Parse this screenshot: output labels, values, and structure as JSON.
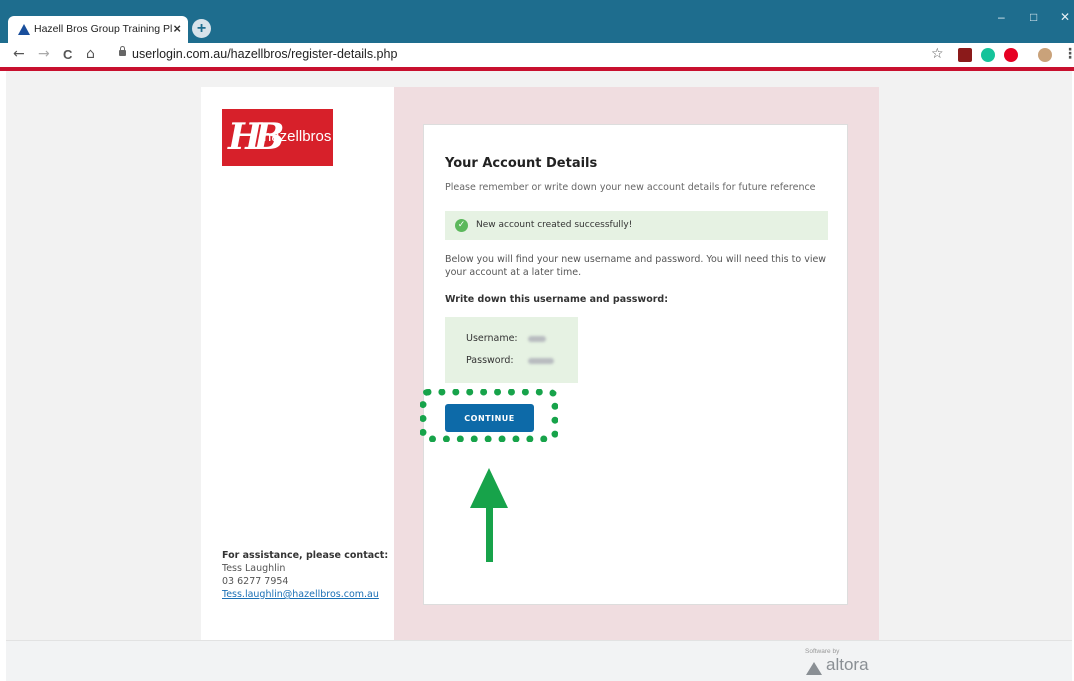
{
  "browser": {
    "tab_title": "Hazell Bros Group Training Platfo",
    "tab_close": "×",
    "new_tab": "+",
    "url": "userlogin.com.au/hazellbros/register-details.php",
    "window_controls": {
      "minimize": "–",
      "maximize": "□",
      "close": "✕"
    },
    "nav": {
      "back": "←",
      "forward": "→",
      "reload": "C",
      "home": "⌂"
    },
    "star": "☆",
    "menu": "⋮"
  },
  "brand": {
    "logo_mark": "HB",
    "logo_text": "hazellbros",
    "color": "#d7202a"
  },
  "card": {
    "title": "Your Account Details",
    "subtitle": "Please remember or write down your new account details for future reference",
    "success_message": "New account created successfully!",
    "info_text": "Below you will find your new username and password. You will need this to view your account at a later time.",
    "write_down_label": "Write down this username and password:",
    "username_label": "Username:",
    "password_label": "Password:",
    "continue_label": "CONTINUE"
  },
  "assistance": {
    "heading": "For assistance, please contact:",
    "name": "Tess Laughlin",
    "phone": "03 6277 7954",
    "email": "Tess.laughlin@hazellbros.com.au"
  },
  "footer": {
    "powered_by": "Software by",
    "vendor": "altora"
  },
  "colors": {
    "chrome": "#1e6d8e",
    "accent_red": "#c8102e",
    "button": "#0d6aa8",
    "annotation_green": "#17a34a",
    "panel_pink": "#f0dde0"
  }
}
